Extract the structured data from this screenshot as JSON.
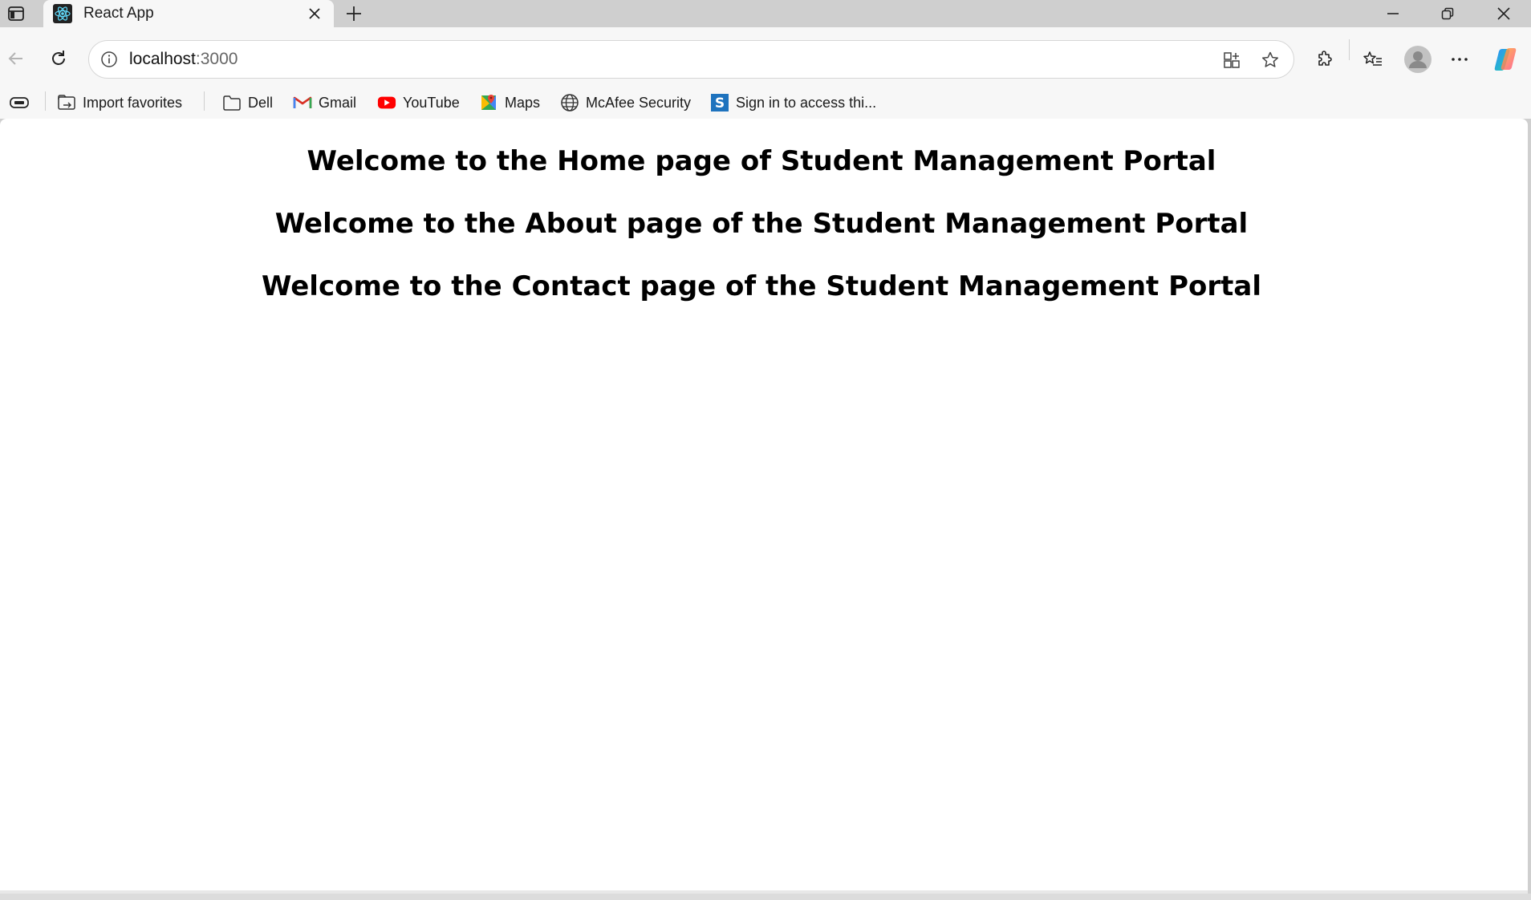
{
  "browser": {
    "tab": {
      "title": "React App"
    },
    "address_bar": {
      "host": "localhost",
      "port": ":3000"
    },
    "bookmarks": [
      {
        "label": "Import favorites",
        "icon": "import-icon"
      },
      {
        "label": "Dell",
        "icon": "folder-icon"
      },
      {
        "label": "Gmail",
        "icon": "gmail-icon"
      },
      {
        "label": "YouTube",
        "icon": "youtube-icon"
      },
      {
        "label": "Maps",
        "icon": "maps-icon"
      },
      {
        "label": "McAfee Security",
        "icon": "globe-icon"
      },
      {
        "label": "Sign in to access thi...",
        "icon": "s-icon"
      }
    ]
  },
  "page": {
    "headings": [
      "Welcome to the Home page of Student Management Portal",
      "Welcome to the About page of the Student Management Portal",
      "Welcome to the Contact page of the Student Management Portal"
    ]
  },
  "colors": {
    "tabstrip_bg": "#cfcfcf",
    "toolbar_bg": "#f7f7f7",
    "page_bg": "#ffffff",
    "youtube_red": "#ff0000",
    "react_blue": "#61dafb"
  }
}
